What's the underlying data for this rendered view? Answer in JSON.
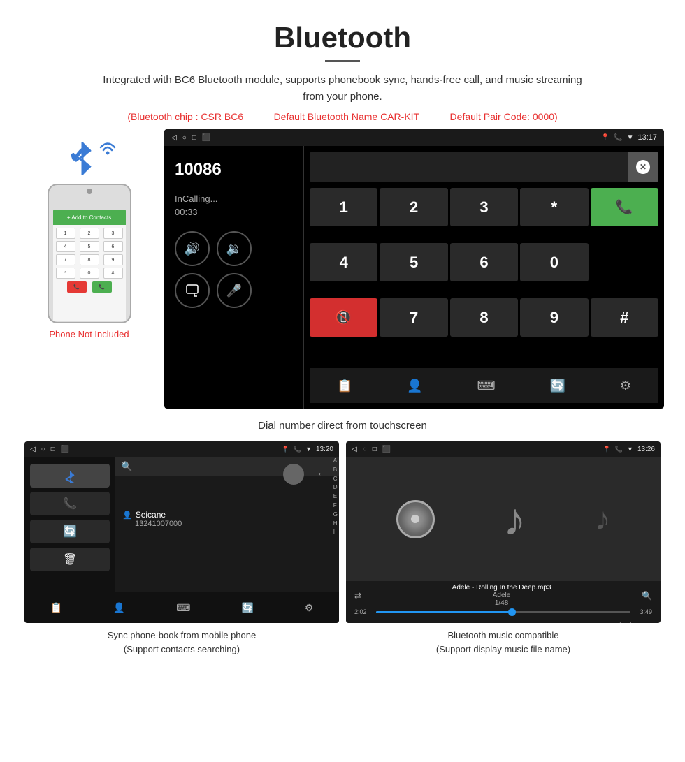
{
  "page": {
    "title": "Bluetooth",
    "description": "Integrated with BC6 Bluetooth module, supports phonebook sync, hands-free call, and music streaming from your phone.",
    "specs": {
      "chip": "(Bluetooth chip : CSR BC6",
      "name": "Default Bluetooth Name CAR-KIT",
      "code": "Default Pair Code: 0000)"
    },
    "call_caption": "Dial number direct from touchscreen",
    "phonebook_caption_line1": "Sync phone-book from mobile phone",
    "phonebook_caption_line2": "(Support contacts searching)",
    "music_caption_line1": "Bluetooth music compatible",
    "music_caption_line2": "(Support display music file name)"
  },
  "dial_screen": {
    "status_time": "13:17",
    "phone_number": "10086",
    "status": "InCalling...",
    "timer": "00:33",
    "keys": [
      "1",
      "2",
      "3",
      "*",
      "4",
      "5",
      "6",
      "0",
      "7",
      "8",
      "9",
      "#"
    ]
  },
  "phonebook_screen": {
    "status_time": "13:20",
    "contact_name": "Seicane",
    "contact_number": "13241007000",
    "alphabet": [
      "A",
      "B",
      "C",
      "D",
      "E",
      "F",
      "G",
      "H",
      "I"
    ]
  },
  "music_screen": {
    "status_time": "13:26",
    "track_name": "Adele - Rolling In the Deep.mp3",
    "artist": "Adele",
    "count": "1/48",
    "time_current": "2:02",
    "time_total": "3:49",
    "progress_percent": 55
  },
  "phone_mock": {
    "not_included": "Phone Not Included",
    "add_contact": "+ Add to Contacts"
  },
  "colors": {
    "accent_red": "#e83030",
    "accent_blue": "#3a7bd5",
    "key_green": "#4CAF50",
    "key_red": "#d32f2f"
  }
}
